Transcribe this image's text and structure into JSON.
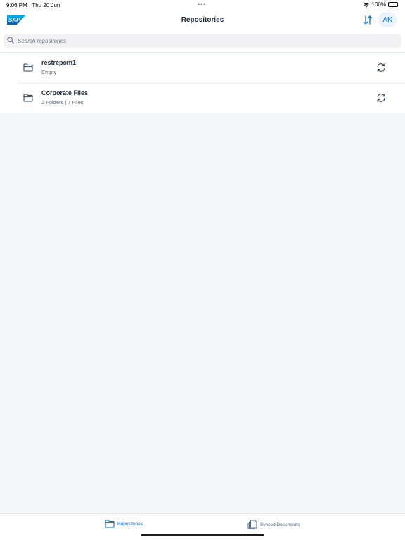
{
  "status_bar": {
    "time": "9:06 PM",
    "date": "Thu 20 Jun",
    "battery": "100%",
    "dots": "•••"
  },
  "header": {
    "logo_text": "SAP",
    "title": "Repositories",
    "avatar_initials": "AK",
    "sort_icon": "sort-arrows-icon"
  },
  "search": {
    "placeholder": "Search repositories",
    "value": ""
  },
  "repositories": [
    {
      "name": "restrepom1",
      "subtitle": "Empty",
      "icon": "folder-icon",
      "action_icon": "sync-icon"
    },
    {
      "name": "Corporate Files",
      "subtitle": "2 Folders | 7 Files",
      "icon": "folder-icon",
      "action_icon": "sync-icon"
    }
  ],
  "tabs": [
    {
      "label": "Repositories",
      "icon": "repository-folder-icon",
      "active": true
    },
    {
      "label": "Synced Documents",
      "icon": "documents-icon",
      "active": false
    }
  ],
  "colors": {
    "accent": "#0a6ed1",
    "text": "#1d2d3e",
    "subtext": "#556b82",
    "background": "#f5f6f7"
  }
}
